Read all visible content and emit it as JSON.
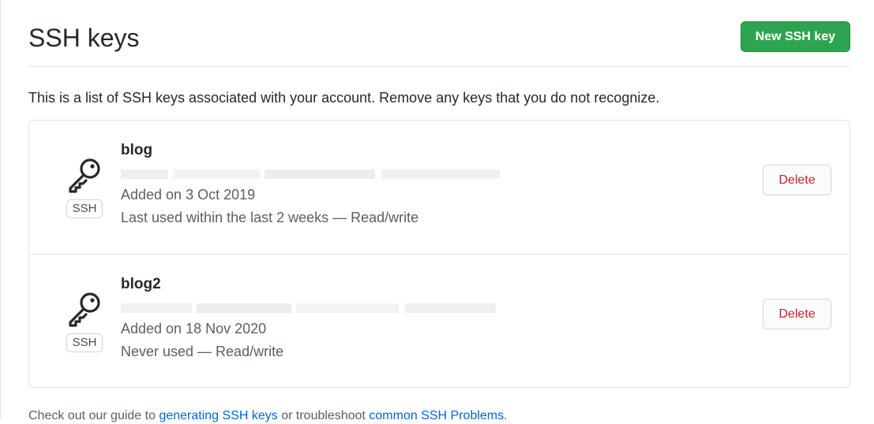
{
  "header": {
    "title": "SSH keys",
    "new_key_button": "New SSH key"
  },
  "intro_text": "This is a list of SSH keys associated with your account. Remove any keys that you do not recognize.",
  "keys": [
    {
      "name": "blog",
      "badge": "SSH",
      "added": "Added on 3 Oct 2019",
      "usage": "Last used within the last 2 weeks — Read/write",
      "delete_label": "Delete"
    },
    {
      "name": "blog2",
      "badge": "SSH",
      "added": "Added on 18 Nov 2020",
      "usage": "Never used — Read/write",
      "delete_label": "Delete"
    }
  ],
  "footer": {
    "prefix": "Check out our guide to",
    "link1": "generating SSH keys",
    "middle": "or troubleshoot",
    "link2": "common SSH Problems",
    "suffix": "."
  },
  "colors": {
    "primary_button": "#2ea44f",
    "danger_text": "#cb2431",
    "link": "#0366d6"
  }
}
